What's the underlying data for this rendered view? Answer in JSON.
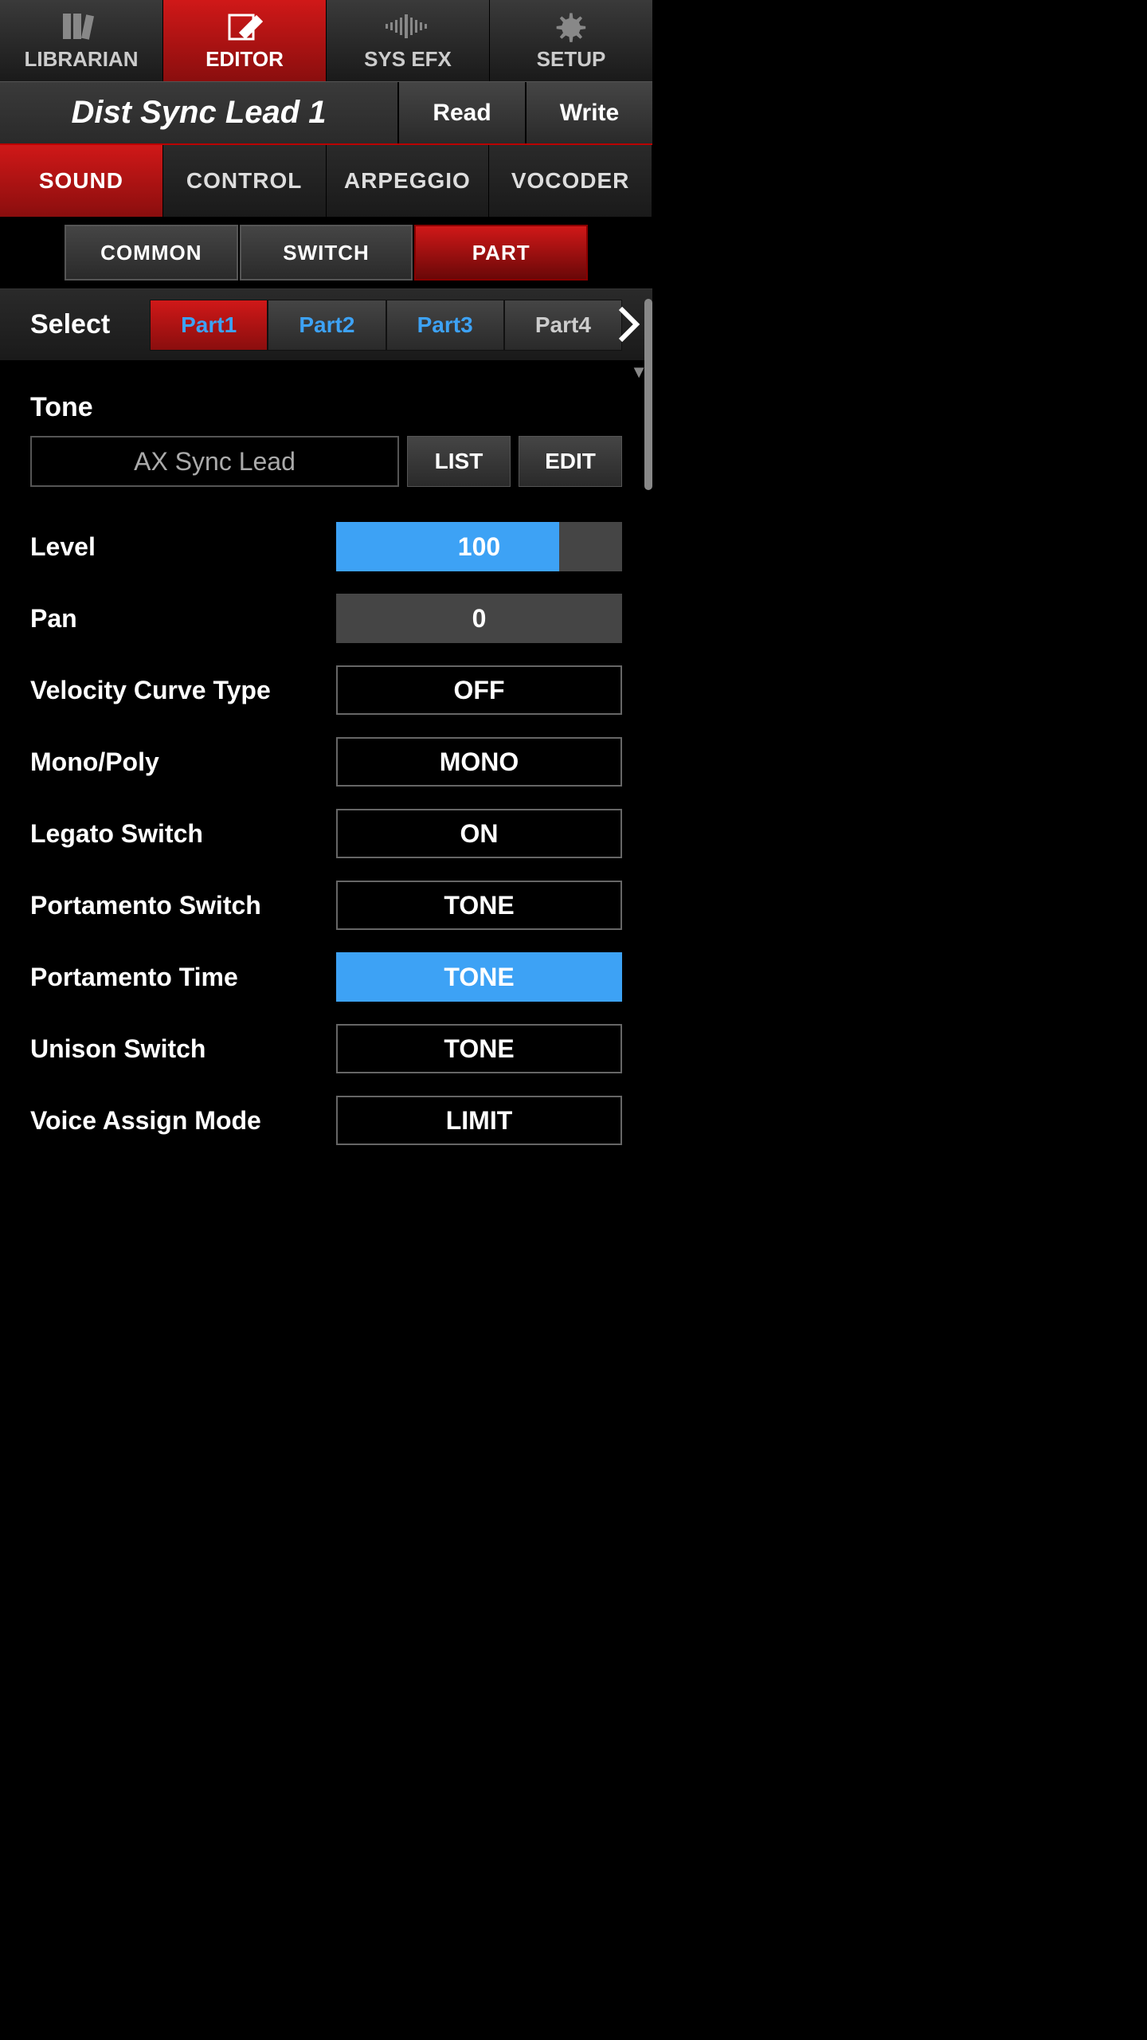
{
  "topnav": {
    "items": [
      {
        "label": "LIBRARIAN",
        "active": false,
        "icon": "books-icon"
      },
      {
        "label": "EDITOR",
        "active": true,
        "icon": "pencil-icon"
      },
      {
        "label": "SYS EFX",
        "active": false,
        "icon": "wave-icon"
      },
      {
        "label": "SETUP",
        "active": false,
        "icon": "gear-icon"
      }
    ]
  },
  "program": {
    "title": "Dist Sync Lead 1",
    "read_label": "Read",
    "write_label": "Write"
  },
  "main_tabs": {
    "items": [
      {
        "label": "SOUND",
        "active": true
      },
      {
        "label": "CONTROL",
        "active": false
      },
      {
        "label": "ARPEGGIO",
        "active": false
      },
      {
        "label": "VOCODER",
        "active": false
      }
    ]
  },
  "sub_tabs": {
    "items": [
      {
        "label": "COMMON",
        "active": false
      },
      {
        "label": "SWITCH",
        "active": false
      },
      {
        "label": "PART",
        "active": true
      }
    ]
  },
  "select": {
    "label": "Select",
    "parts": [
      {
        "label": "Part1",
        "active": true,
        "enabled": true
      },
      {
        "label": "Part2",
        "active": false,
        "enabled": true
      },
      {
        "label": "Part3",
        "active": false,
        "enabled": true
      },
      {
        "label": "Part4",
        "active": false,
        "enabled": false
      }
    ]
  },
  "tone": {
    "section_title": "Tone",
    "name": "AX Sync Lead",
    "list_label": "LIST",
    "edit_label": "EDIT"
  },
  "params": [
    {
      "label": "Level",
      "type": "slider",
      "value": "100",
      "fill_pct": 78
    },
    {
      "label": "Pan",
      "type": "slider",
      "value": "0",
      "fill_pct": 0
    },
    {
      "label": "Velocity Curve Type",
      "type": "select",
      "value": "OFF",
      "filled": false
    },
    {
      "label": "Mono/Poly",
      "type": "select",
      "value": "MONO",
      "filled": false
    },
    {
      "label": "Legato Switch",
      "type": "select",
      "value": "ON",
      "filled": false
    },
    {
      "label": "Portamento Switch",
      "type": "select",
      "value": "TONE",
      "filled": false
    },
    {
      "label": "Portamento Time",
      "type": "select",
      "value": "TONE",
      "filled": true
    },
    {
      "label": "Unison Switch",
      "type": "select",
      "value": "TONE",
      "filled": false
    },
    {
      "label": "Voice Assign Mode",
      "type": "select",
      "value": "LIMIT",
      "filled": false
    }
  ]
}
